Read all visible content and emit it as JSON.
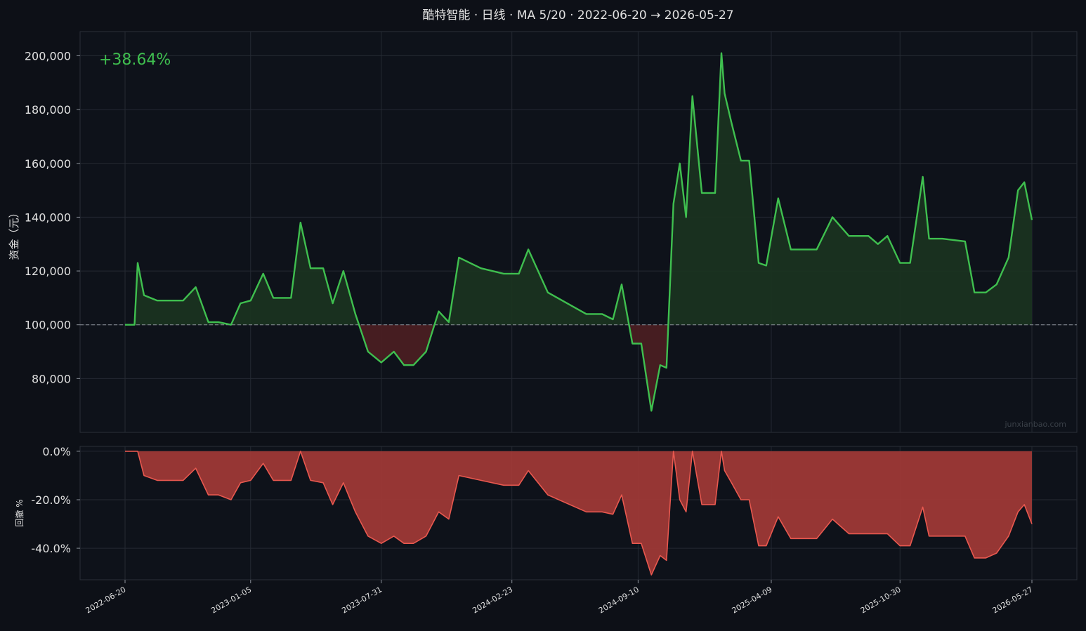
{
  "page": {
    "title": "酷特智能 · 日线 · MA 5/20 · 2022-06-20 → 2026-05-27",
    "return_label": "+38.64%",
    "watermark": "junxianbao.com"
  },
  "colors": {
    "background": "#0d1017",
    "plot_bg": "#0e121a",
    "grid": "#252a33",
    "text": "#e0e0e0",
    "equity_line": "#3fbf4f",
    "gain_fill": "#1a3320",
    "loss_fill": "#4a1f22",
    "drawdown_line": "#e8584f",
    "drawdown_fill": "#a23a36"
  },
  "chart_data": [
    {
      "type": "line",
      "ylabel": "资金（元）",
      "baseline": 100000,
      "ylim": [
        60000,
        209000
      ],
      "yticks": [
        80000,
        100000,
        120000,
        140000,
        160000,
        180000,
        200000
      ],
      "ytick_labels": [
        "80,000",
        "100,000",
        "120,000",
        "140,000",
        "160,000",
        "180,000",
        "200,000"
      ],
      "grid": true,
      "series": [
        {
          "x": [
            "2022-06-20",
            "2022-07-05",
            "2022-07-10",
            "2022-07-20",
            "2022-08-10",
            "2022-09-20",
            "2022-10-10",
            "2022-10-30",
            "2022-11-15",
            "2022-12-05",
            "2022-12-20",
            "2023-01-05",
            "2023-01-25",
            "2023-02-10",
            "2023-03-10",
            "2023-03-25",
            "2023-04-10",
            "2023-04-30",
            "2023-05-15",
            "2023-06-01",
            "2023-06-20",
            "2023-07-10",
            "2023-07-31",
            "2023-08-20",
            "2023-09-05",
            "2023-09-20",
            "2023-10-10",
            "2023-10-30",
            "2023-11-15",
            "2023-12-01",
            "2024-01-05",
            "2024-02-10",
            "2024-03-05",
            "2024-03-20",
            "2024-04-20",
            "2024-06-20",
            "2024-07-15",
            "2024-08-01",
            "2024-08-15",
            "2024-09-01",
            "2024-09-15",
            "2024-10-01",
            "2024-10-15",
            "2024-10-25",
            "2024-11-05",
            "2024-11-15",
            "2024-11-25",
            "2024-12-05",
            "2024-12-20",
            "2025-01-10",
            "2025-01-20",
            "2025-01-25",
            "2025-02-05",
            "2025-02-20",
            "2025-03-05",
            "2025-03-20",
            "2025-04-01",
            "2025-04-20",
            "2025-05-10",
            "2025-06-20",
            "2025-07-15",
            "2025-08-10",
            "2025-09-10",
            "2025-09-25",
            "2025-10-10",
            "2025-10-30",
            "2025-11-15",
            "2025-12-05",
            "2025-12-15",
            "2026-01-05",
            "2026-02-10",
            "2026-02-25",
            "2026-03-15",
            "2026-04-01",
            "2026-04-20",
            "2026-05-05",
            "2026-05-15",
            "2026-05-27"
          ],
          "y": [
            100000,
            100000,
            123000,
            111000,
            109000,
            109000,
            114000,
            101000,
            101000,
            100000,
            108000,
            109000,
            119000,
            110000,
            110000,
            138000,
            121000,
            121000,
            108000,
            120000,
            104000,
            90000,
            86000,
            90000,
            85000,
            85000,
            90000,
            105000,
            101000,
            125000,
            121000,
            119000,
            119000,
            128000,
            112000,
            104000,
            104000,
            102000,
            115000,
            93000,
            93000,
            68000,
            85000,
            84000,
            145000,
            160000,
            140000,
            185000,
            149000,
            149000,
            201000,
            186000,
            175000,
            161000,
            161000,
            123000,
            122000,
            147000,
            128000,
            128000,
            140000,
            133000,
            133000,
            130000,
            133000,
            123000,
            123000,
            155000,
            132000,
            132000,
            131000,
            112000,
            112000,
            115000,
            125000,
            150000,
            153000,
            139000
          ]
        }
      ]
    },
    {
      "type": "area",
      "ylabel": "回撤 %",
      "ylim": [
        -53,
        2
      ],
      "yticks": [
        0,
        -20,
        -40
      ],
      "ytick_labels": [
        "0.0%",
        "-20.0%",
        "-40.0%"
      ],
      "grid": true,
      "series": [
        {
          "x": [
            "2022-06-20",
            "2022-07-10",
            "2022-07-20",
            "2022-08-10",
            "2022-09-20",
            "2022-10-10",
            "2022-10-30",
            "2022-11-15",
            "2022-12-05",
            "2022-12-20",
            "2023-01-05",
            "2023-01-25",
            "2023-02-10",
            "2023-03-10",
            "2023-03-25",
            "2023-04-10",
            "2023-04-30",
            "2023-05-15",
            "2023-06-01",
            "2023-06-20",
            "2023-07-10",
            "2023-07-31",
            "2023-08-20",
            "2023-09-05",
            "2023-09-20",
            "2023-10-10",
            "2023-10-30",
            "2023-11-15",
            "2023-12-01",
            "2024-01-05",
            "2024-02-10",
            "2024-03-05",
            "2024-03-20",
            "2024-04-20",
            "2024-06-20",
            "2024-07-15",
            "2024-08-01",
            "2024-08-15",
            "2024-09-01",
            "2024-09-15",
            "2024-10-01",
            "2024-10-15",
            "2024-10-25",
            "2024-11-05",
            "2024-11-15",
            "2024-11-25",
            "2024-12-05",
            "2024-12-20",
            "2025-01-10",
            "2025-01-20",
            "2025-01-25",
            "2025-02-05",
            "2025-02-20",
            "2025-03-05",
            "2025-03-20",
            "2025-04-01",
            "2025-04-20",
            "2025-05-10",
            "2025-06-20",
            "2025-07-15",
            "2025-08-10",
            "2025-09-10",
            "2025-09-25",
            "2025-10-10",
            "2025-10-30",
            "2025-11-15",
            "2025-12-05",
            "2025-12-15",
            "2026-01-05",
            "2026-02-10",
            "2026-02-25",
            "2026-03-15",
            "2026-04-01",
            "2026-04-20",
            "2026-05-05",
            "2026-05-15",
            "2026-05-27"
          ],
          "y": [
            0,
            0,
            -10,
            -12,
            -12,
            -7,
            -18,
            -18,
            -20,
            -13,
            -12,
            -5,
            -12,
            -12,
            0,
            -12,
            -13,
            -22,
            -13,
            -25,
            -35,
            -38,
            -35,
            -38,
            -38,
            -35,
            -25,
            -28,
            -10,
            -12,
            -14,
            -14,
            -8,
            -18,
            -25,
            -25,
            -26,
            -18,
            -38,
            -38,
            -51,
            -43,
            -45,
            0,
            -20,
            -25,
            0,
            -22,
            -22,
            0,
            -8,
            -13,
            -20,
            -20,
            -39,
            -39,
            -27,
            -36,
            -36,
            -28,
            -34,
            -34,
            -34,
            -34,
            -39,
            -39,
            -23,
            -35,
            -35,
            -35,
            -44,
            -44,
            -42,
            -35,
            -25,
            -22,
            -30
          ]
        }
      ]
    }
  ],
  "x_axis": {
    "ticks": [
      "2022-06-20",
      "2023-01-05",
      "2023-07-31",
      "2024-02-23",
      "2024-09-10",
      "2025-04-09",
      "2025-10-30",
      "2026-05-27"
    ]
  }
}
